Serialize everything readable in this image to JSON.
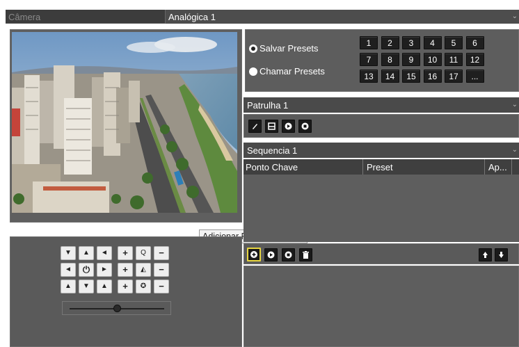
{
  "camera_bar": {
    "label": "Câmera",
    "selected_value": "Analógica 1"
  },
  "presets": {
    "save_label": "Salvar Presets",
    "call_label": "Chamar Presets",
    "numbers": [
      "1",
      "2",
      "3",
      "4",
      "5",
      "6",
      "7",
      "8",
      "9",
      "10",
      "11",
      "12",
      "13",
      "14",
      "15",
      "16",
      "17",
      "..."
    ]
  },
  "patrol": {
    "selected_value": "Patrulha 1",
    "icons": [
      "pencil-icon",
      "save-icon",
      "play-icon",
      "stop-icon"
    ]
  },
  "sequence": {
    "selected_value": "Sequencia 1",
    "columns": [
      "Ponto Chave",
      "Preset",
      "Ap..."
    ]
  },
  "tooltip": {
    "text": "Adicionar Ponto Chave"
  },
  "sequence_toolbar": {
    "icons": [
      "add-keypoint-icon",
      "play-icon",
      "stop-icon",
      "trash-icon",
      "arrow-up-icon",
      "arrow-down-icon"
    ]
  },
  "ptz_controls": {
    "rows": [
      [
        "▼",
        "▲",
        "◄",
        "+",
        "Q",
        "−"
      ],
      [
        "◄",
        "⏻",
        "►",
        "+",
        "◭",
        "−"
      ],
      [
        "▲",
        "▼",
        "▲",
        "+",
        "✪",
        "−"
      ]
    ],
    "speed_level": 0.5
  },
  "colors": {
    "panel": "#5f5f5f",
    "bar": "#4a4a4a",
    "button": "#1f1f1f",
    "highlight": "#e8d640"
  }
}
